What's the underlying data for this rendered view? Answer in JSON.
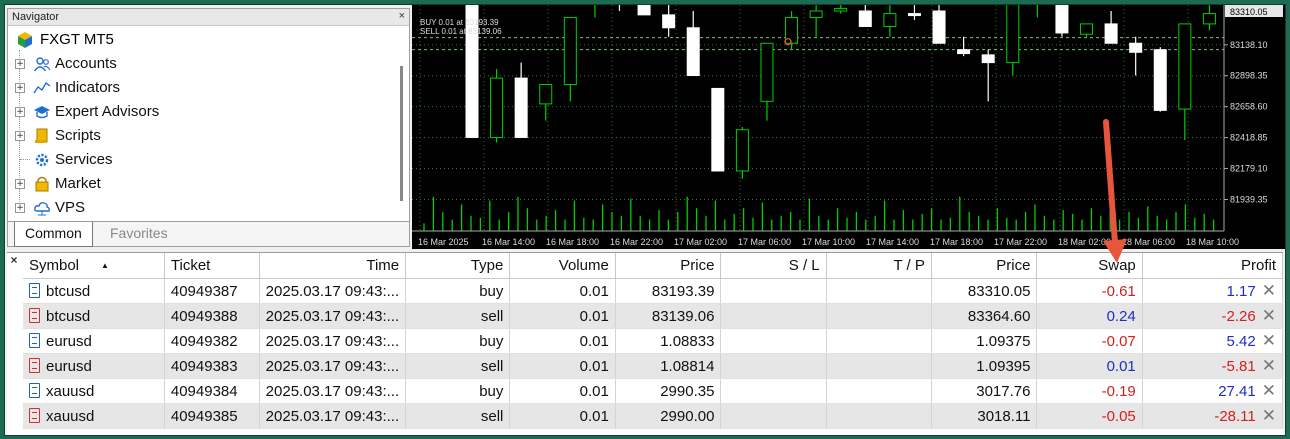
{
  "navigator": {
    "title": "Navigator",
    "close": "×",
    "root": "FXGT MT5",
    "items": [
      {
        "label": "Accounts",
        "icon": "accounts-icon",
        "expandable": true
      },
      {
        "label": "Indicators",
        "icon": "indicators-icon",
        "expandable": true
      },
      {
        "label": "Expert Advisors",
        "icon": "expert-advisors-icon",
        "expandable": true
      },
      {
        "label": "Scripts",
        "icon": "scripts-icon",
        "expandable": true
      },
      {
        "label": "Services",
        "icon": "services-icon",
        "expandable": false
      },
      {
        "label": "Market",
        "icon": "market-icon",
        "expandable": true
      },
      {
        "label": "VPS",
        "icon": "vps-icon",
        "expandable": true
      }
    ],
    "tabs": [
      "Common",
      "Favorites"
    ],
    "active_tab": "Common"
  },
  "chart": {
    "trade_labels": [
      "BUY 0.01 at 83193.39",
      "SELL 0.01 at 83139.06"
    ],
    "current_price": "83310.05",
    "price_ticks": [
      "83138.10",
      "82898.35",
      "82658.60",
      "82418.85",
      "82179.10",
      "81939.35"
    ],
    "time_ticks": [
      "16 Mar 2025",
      "16 Mar 14:00",
      "16 Mar 18:00",
      "16 Mar 22:00",
      "17 Mar 02:00",
      "17 Mar 06:00",
      "17 Mar 10:00",
      "17 Mar 14:00",
      "17 Mar 18:00",
      "17 Mar 22:00",
      "18 Mar 02:00",
      "18 Mar 06:00",
      "18 Mar 10:00"
    ],
    "colors": {
      "background": "#000000",
      "bull": "#00d000",
      "bear": "#ffffff",
      "grid": "#3a6e3a"
    }
  },
  "chart_data": {
    "type": "candlestick",
    "price_axis_ticks": [
      83138.1,
      82898.35,
      82658.6,
      82418.85,
      82179.1,
      81939.35
    ],
    "current_price": 83310.05,
    "trade_levels": [
      {
        "label": "BUY 0.01 at 83193.39",
        "price": 83193.39
      },
      {
        "label": "SELL 0.01 at 83139.06",
        "price": 83139.06
      }
    ],
    "candles": [
      {
        "o": 83500,
        "h": 83600,
        "l": 82420,
        "c": 82420
      },
      {
        "o": 82420,
        "h": 82950,
        "l": 82380,
        "c": 82880
      },
      {
        "o": 82880,
        "h": 83000,
        "l": 82420,
        "c": 82420
      },
      {
        "o": 82680,
        "h": 82830,
        "l": 82550,
        "c": 82830
      },
      {
        "o": 82830,
        "h": 83350,
        "l": 82700,
        "c": 83350
      },
      {
        "o": 83500,
        "h": 83600,
        "l": 83350,
        "c": 83500
      },
      {
        "o": 83500,
        "h": 83600,
        "l": 83400,
        "c": 83450
      },
      {
        "o": 83500,
        "h": 83600,
        "l": 83370,
        "c": 83370
      },
      {
        "o": 83370,
        "h": 83600,
        "l": 83200,
        "c": 83270
      },
      {
        "o": 83270,
        "h": 83400,
        "l": 82900,
        "c": 82900
      },
      {
        "o": 82800,
        "h": 82800,
        "l": 82160,
        "c": 82160
      },
      {
        "o": 82160,
        "h": 82500,
        "l": 82100,
        "c": 82480
      },
      {
        "o": 82700,
        "h": 83150,
        "l": 82550,
        "c": 83150
      },
      {
        "o": 83150,
        "h": 83400,
        "l": 83100,
        "c": 83350
      },
      {
        "o": 83350,
        "h": 83450,
        "l": 83200,
        "c": 83400
      },
      {
        "o": 83400,
        "h": 83600,
        "l": 83380,
        "c": 83420
      },
      {
        "o": 83400,
        "h": 83600,
        "l": 83280,
        "c": 83280
      },
      {
        "o": 83280,
        "h": 83500,
        "l": 83200,
        "c": 83380
      },
      {
        "o": 83380,
        "h": 83500,
        "l": 83330,
        "c": 83370
      },
      {
        "o": 83400,
        "h": 83500,
        "l": 83150,
        "c": 83150
      },
      {
        "o": 83100,
        "h": 83200,
        "l": 83050,
        "c": 83070
      },
      {
        "o": 83060,
        "h": 83100,
        "l": 82700,
        "c": 83000
      },
      {
        "o": 83000,
        "h": 83500,
        "l": 82900,
        "c": 83450
      },
      {
        "o": 83480,
        "h": 83600,
        "l": 83350,
        "c": 83480
      },
      {
        "o": 83480,
        "h": 83550,
        "l": 83200,
        "c": 83230
      },
      {
        "o": 83220,
        "h": 83300,
        "l": 83200,
        "c": 83300
      },
      {
        "o": 83300,
        "h": 83400,
        "l": 83150,
        "c": 83150
      },
      {
        "o": 83150,
        "h": 83200,
        "l": 82900,
        "c": 83080
      },
      {
        "o": 83100,
        "h": 83120,
        "l": 82620,
        "c": 82630
      },
      {
        "o": 82640,
        "h": 83300,
        "l": 82400,
        "c": 83300
      },
      {
        "o": 83300,
        "h": 83450,
        "l": 83250,
        "c": 83380
      }
    ],
    "volume_relative": [
      0.2,
      0.9,
      0.5,
      0.3,
      0.7,
      0.4,
      0.35,
      0.8,
      0.3,
      0.5,
      0.9,
      0.6,
      0.3,
      0.4,
      0.55,
      0.3,
      0.8,
      0.35,
      0.3,
      0.7,
      0.5,
      0.4,
      0.85,
      0.4,
      0.3,
      0.55,
      0.3,
      0.5,
      0.9,
      0.6,
      0.4,
      0.8,
      0.3,
      0.45,
      0.6,
      0.35,
      0.75,
      0.3,
      0.4,
      0.5,
      0.3,
      0.85,
      0.4,
      0.3,
      0.6,
      0.35,
      0.5,
      0.3,
      0.4,
      0.8,
      0.3,
      0.55,
      0.3,
      0.45,
      0.6,
      0.3,
      0.35,
      0.9,
      0.5,
      0.4,
      0.3,
      0.6,
      0.35,
      0.3,
      0.5,
      0.7,
      0.4,
      0.3,
      0.55,
      0.45,
      0.3,
      0.6,
      0.4,
      0.8,
      0.3,
      0.5,
      0.35,
      0.65,
      0.4,
      0.3,
      0.5,
      0.7,
      0.35,
      0.45,
      0.3,
      0.6
    ]
  },
  "table": {
    "columns": [
      "Symbol",
      "Ticket",
      "Time",
      "Type",
      "Volume",
      "Price",
      "S / L",
      "T / P",
      "Price",
      "Swap",
      "Profit"
    ],
    "rows": [
      {
        "symbol": "btcusd",
        "ticket": "40949387",
        "time": "2025.03.17 09:43:...",
        "type": "buy",
        "volume": "0.01",
        "price": "83193.39",
        "sl": "",
        "tp": "",
        "current": "83310.05",
        "swap": "-0.61",
        "profit": "1.17"
      },
      {
        "symbol": "btcusd",
        "ticket": "40949388",
        "time": "2025.03.17 09:43:...",
        "type": "sell",
        "volume": "0.01",
        "price": "83139.06",
        "sl": "",
        "tp": "",
        "current": "83364.60",
        "swap": "0.24",
        "profit": "-2.26"
      },
      {
        "symbol": "eurusd",
        "ticket": "40949382",
        "time": "2025.03.17 09:43:...",
        "type": "buy",
        "volume": "0.01",
        "price": "1.08833",
        "sl": "",
        "tp": "",
        "current": "1.09375",
        "swap": "-0.07",
        "profit": "5.42"
      },
      {
        "symbol": "eurusd",
        "ticket": "40949383",
        "time": "2025.03.17 09:43:...",
        "type": "sell",
        "volume": "0.01",
        "price": "1.08814",
        "sl": "",
        "tp": "",
        "current": "1.09395",
        "swap": "0.01",
        "profit": "-5.81"
      },
      {
        "symbol": "xauusd",
        "ticket": "40949384",
        "time": "2025.03.17 09:43:...",
        "type": "buy",
        "volume": "0.01",
        "price": "2990.35",
        "sl": "",
        "tp": "",
        "current": "3017.76",
        "swap": "-0.19",
        "profit": "27.41"
      },
      {
        "symbol": "xauusd",
        "ticket": "40949385",
        "time": "2025.03.17 09:43:...",
        "type": "sell",
        "volume": "0.01",
        "price": "2990.00",
        "sl": "",
        "tp": "",
        "current": "3018.11",
        "swap": "-0.05",
        "profit": "-28.11"
      }
    ],
    "close_glyph": "✕",
    "side_close": "×"
  },
  "annotation": {
    "arrow_color": "#e8553d",
    "target": "swap-column"
  }
}
